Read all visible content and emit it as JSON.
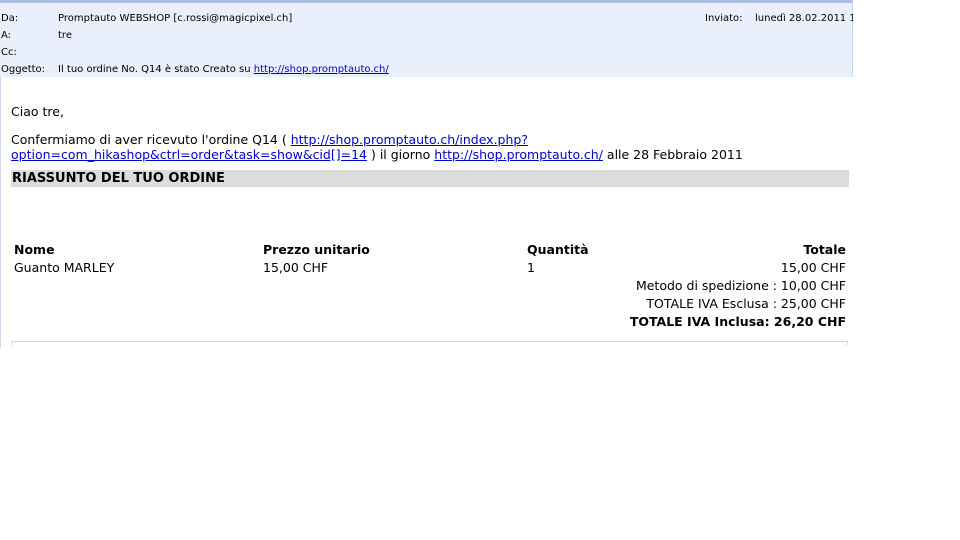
{
  "header": {
    "from_label": "Da:",
    "from_value": "Promptauto WEBSHOP [c.rossi@magicpixel.ch]",
    "to_label": "A:",
    "to_value": "tre",
    "cc_label": "Cc:",
    "cc_value": "",
    "subject_label": "Oggetto:",
    "subject_text": "Il tuo ordine No. Q14 è stato Creato su",
    "subject_link": "http://shop.promptauto.ch/",
    "sent_label": "Inviato:",
    "sent_value": "lunedì 28.02.2011 1"
  },
  "message": {
    "greeting": "Ciao tre,",
    "confirm_prefix": "Confermiamo di aver ricevuto l'ordine Q14 (",
    "order_link_part1": "http://shop.promptauto.ch/index.php?",
    "order_link_part2": "option=com_hikashop&ctrl=order&task=show&cid[]=14",
    "confirm_middle": ") il giorno",
    "shop_link": "http://shop.promptauto.ch/",
    "confirm_suffix": "alle 28 Febbraio 2011",
    "summary_title": "RIASSUNTO DEL TUO ORDINE"
  },
  "order_table": {
    "headers": [
      "Nome",
      "Prezzo unitario",
      "Quantità",
      "Totale"
    ],
    "rows": [
      [
        "Guanto MARLEY",
        "15,00 CHF",
        "1",
        "15,00 CHF"
      ]
    ],
    "shipping": "Metodo di spedizione : 10,00 CHF",
    "total_excl": "TOTALE IVA Esclusa : 25,00 CHF",
    "total_incl": "TOTALE IVA Inclusa: 26,20 CHF"
  }
}
